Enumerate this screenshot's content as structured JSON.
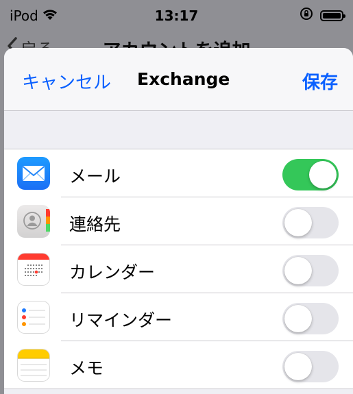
{
  "status_bar": {
    "carrier": "iPod",
    "time": "13:17"
  },
  "background_nav": {
    "back_label": "戻る",
    "title": "アカウントを追加"
  },
  "sheet": {
    "cancel_label": "キャンセル",
    "title": "Exchange",
    "save_label": "保存"
  },
  "sync_items": [
    {
      "label": "メール",
      "icon": "mail-icon",
      "enabled": true
    },
    {
      "label": "連絡先",
      "icon": "contacts-icon",
      "enabled": false
    },
    {
      "label": "カレンダー",
      "icon": "calendar-icon",
      "enabled": false
    },
    {
      "label": "リマインダー",
      "icon": "reminders-icon",
      "enabled": false
    },
    {
      "label": "メモ",
      "icon": "notes-icon",
      "enabled": false
    }
  ],
  "colors": {
    "accent": "#0a60ff",
    "toggle_on": "#34c759",
    "toggle_off": "#e5e5ea"
  }
}
